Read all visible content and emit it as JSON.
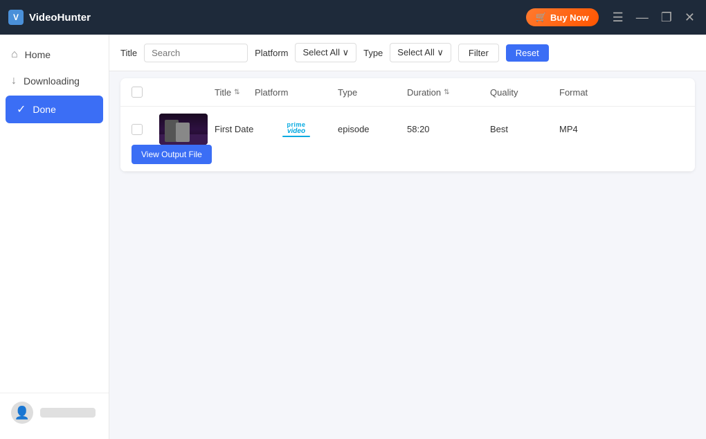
{
  "app": {
    "name": "VideoHunter",
    "logo_char": "V"
  },
  "titlebar": {
    "buy_now_label": "Buy Now",
    "menu_icon": "☰",
    "minimize_icon": "—",
    "maximize_icon": "❐",
    "close_icon": "✕"
  },
  "sidebar": {
    "items": [
      {
        "id": "home",
        "label": "Home",
        "icon": "⌂",
        "active": false
      },
      {
        "id": "downloading",
        "label": "Downloading",
        "icon": "↓",
        "active": false
      },
      {
        "id": "done",
        "label": "Done",
        "icon": "✓",
        "active": true
      }
    ]
  },
  "toolbar": {
    "title_label": "Title",
    "search_placeholder": "Search",
    "platform_label": "Platform",
    "platform_select": "Select All ∨",
    "type_label": "Type",
    "type_select": "Select All ∨",
    "filter_label": "Filter",
    "reset_label": "Reset"
  },
  "table": {
    "columns": [
      {
        "id": "checkbox",
        "label": ""
      },
      {
        "id": "thumbnail",
        "label": ""
      },
      {
        "id": "title",
        "label": "Title",
        "sortable": true
      },
      {
        "id": "platform",
        "label": "Platform"
      },
      {
        "id": "type",
        "label": "Type"
      },
      {
        "id": "duration",
        "label": "Duration",
        "sortable": true
      },
      {
        "id": "quality",
        "label": "Quality"
      },
      {
        "id": "format",
        "label": "Format"
      },
      {
        "id": "action",
        "label": ""
      }
    ],
    "rows": [
      {
        "title": "First Date",
        "platform": "Amazon Prime Video",
        "type": "episode",
        "duration": "58:20",
        "quality": "Best",
        "format": "MP4",
        "action_label": "View Output File"
      }
    ]
  }
}
